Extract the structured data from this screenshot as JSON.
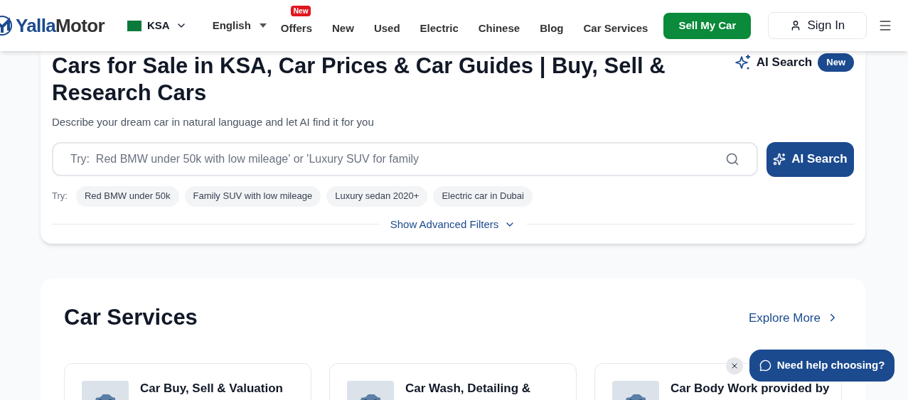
{
  "header": {
    "logo": {
      "part_1": "Yalla",
      "part_2": "Motor"
    },
    "country": "KSA",
    "language": "English",
    "nav": [
      {
        "label": "Offers",
        "badge": "New"
      },
      {
        "label": "New"
      },
      {
        "label": "Used"
      },
      {
        "label": "Electric"
      },
      {
        "label": "Chinese"
      },
      {
        "label": "Blog"
      },
      {
        "label": "Car Services"
      }
    ],
    "sell_button": "Sell My Car",
    "sign_in": "Sign In"
  },
  "hero": {
    "title": "Cars for Sale in KSA, Car Prices & Car Guides | Buy, Sell & Research Cars",
    "ai_label": "AI Search",
    "ai_badge": "New",
    "subtitle": "Describe your dream car in natural language and let AI find it for you",
    "search": {
      "placeholder": "Try:  Red BMW under 50k with low mileage' or 'Luxury SUV for family"
    },
    "search_button": "AI Search",
    "try_label": "Try:",
    "suggestions": [
      "Red BMW under 50k",
      "Family SUV with low mileage",
      "Luxury sedan 2020+",
      "Electric car in Dubai"
    ],
    "advanced_filters": "Show Advanced Filters"
  },
  "services": {
    "title": "Car Services",
    "explore": "Explore More",
    "cards": [
      {
        "title": "Car Buy, Sell & Valuation"
      },
      {
        "title": "Car Wash, Detailing &"
      },
      {
        "title": "Car Body Work provided by"
      }
    ]
  },
  "help_chat": {
    "label": "Need help choosing?"
  }
}
